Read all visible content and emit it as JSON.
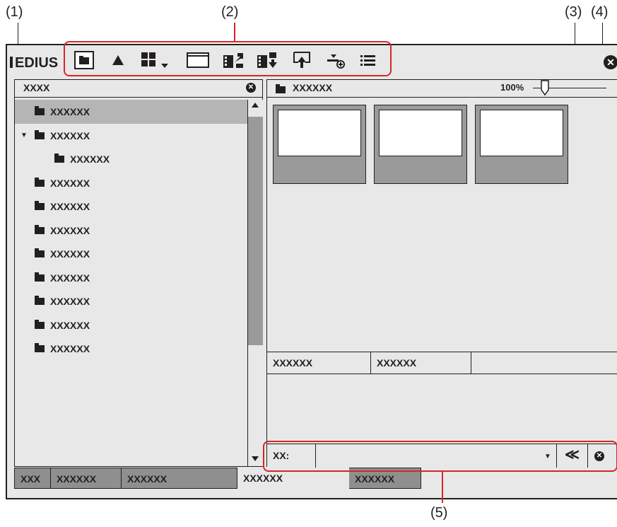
{
  "callouts": {
    "c1": "(1)",
    "c2": "(2)",
    "c3": "(3)",
    "c4": "(4)",
    "c5": "(5)"
  },
  "window": {
    "brand": "EDIUS"
  },
  "toolbar": {
    "items": [
      {
        "name": "folder-view-icon"
      },
      {
        "name": "up-arrow-icon"
      },
      {
        "name": "view-mode-icon"
      },
      {
        "name": "preview-window-icon"
      },
      {
        "name": "send-to-player-icon"
      },
      {
        "name": "add-to-timeline-icon"
      },
      {
        "name": "import-icon"
      },
      {
        "name": "add-clip-icon"
      },
      {
        "name": "list-icon"
      }
    ]
  },
  "left_panel": {
    "title": "XXXX",
    "tree": [
      {
        "label": "XXXXXX",
        "selected": true
      },
      {
        "label": "XXXXXX",
        "expanded": true
      },
      {
        "label": "XXXXXX"
      },
      {
        "label": "XXXXXX"
      },
      {
        "label": "XXXXXX"
      },
      {
        "label": "XXXXXX"
      },
      {
        "label": "XXXXXX"
      },
      {
        "label": "XXXXXX"
      },
      {
        "label": "XXXXXX"
      },
      {
        "label": "XXXXXX"
      },
      {
        "label": "XXXXXX"
      }
    ]
  },
  "right_panel": {
    "title": "XXXXXX",
    "zoom": "100%",
    "props": {
      "col1": "XXXXXX",
      "col2": "XXXXXX"
    },
    "search": {
      "label": "XX:",
      "back": "≪"
    }
  },
  "tabs": [
    "XXX",
    "XXXXXX",
    "XXXXXX",
    "XXXXXX",
    "XXXXXX"
  ],
  "colors": {
    "highlight": "#d7262a",
    "panel_bg": "#e8e8e8",
    "selected_bg": "#b5b5b5",
    "tab_bg": "#8f8f8f"
  }
}
